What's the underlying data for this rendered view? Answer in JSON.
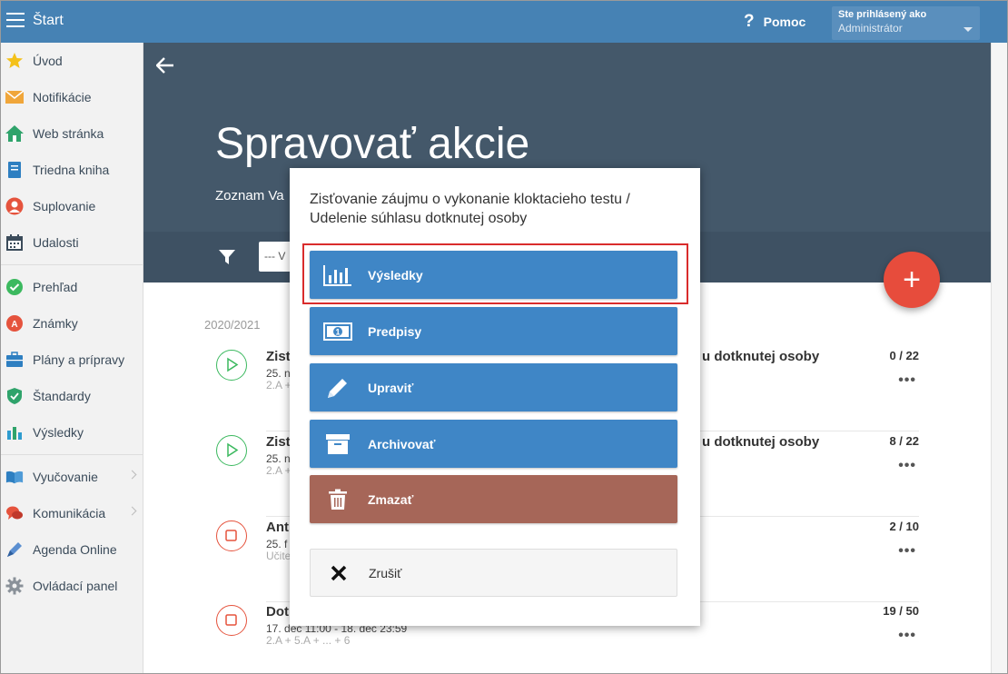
{
  "topbar": {
    "brand": "Štart",
    "help_label": "Pomoc",
    "user_line1": "Ste prihlásený ako",
    "user_line2": "Administrátor"
  },
  "sidebar": {
    "items": [
      {
        "label": "Úvod",
        "icon": "star-icon"
      },
      {
        "label": "Notifikácie",
        "icon": "envelope-icon"
      },
      {
        "label": "Web stránka",
        "icon": "house-icon"
      },
      {
        "label": "Triedna kniha",
        "icon": "book-icon"
      },
      {
        "label": "Suplovanie",
        "icon": "person-icon"
      },
      {
        "label": "Udalosti",
        "icon": "calendar-icon"
      },
      {
        "label": "Prehľad",
        "icon": "check-circle-icon"
      },
      {
        "label": "Známky",
        "icon": "grade-icon"
      },
      {
        "label": "Plány a prípravy",
        "icon": "briefcase-icon"
      },
      {
        "label": "Štandardy",
        "icon": "shield-icon"
      },
      {
        "label": "Výsledky",
        "icon": "bar-chart-icon"
      },
      {
        "label": "Vyučovanie",
        "icon": "open-book-icon"
      },
      {
        "label": "Komunikácia",
        "icon": "chat-icon"
      },
      {
        "label": "Agenda Online",
        "icon": "pen-icon"
      },
      {
        "label": "Ovládací panel",
        "icon": "gear-icon"
      }
    ]
  },
  "hero": {
    "title": "Spravovať akcie",
    "subtitle": "Zoznam Va"
  },
  "filter": {
    "select_value": "--- V"
  },
  "list": {
    "year": "2020/2021",
    "rows": [
      {
        "t1": "Zist",
        "t2": "25. n",
        "t3": "2.A +",
        "right": "u dotknutej osoby",
        "count": "0 / 22",
        "status": "play"
      },
      {
        "t1": "Zist",
        "t2": "25. n",
        "t3": "2.A +",
        "right": "u dotknutej osoby",
        "count": "8 / 22",
        "status": "play"
      },
      {
        "t1": "Ant",
        "t2": "25. f",
        "t3": "Učite",
        "right": "",
        "count": "2 / 10",
        "status": "stop"
      },
      {
        "t1": "Dot",
        "t2": "17. dec 11:00 - 18. dec 23:59",
        "t3": "2.A + 5.A + ... + 6",
        "right": "",
        "count": "19 / 50",
        "status": "stop"
      }
    ],
    "dots": "•••"
  },
  "modal": {
    "title": "Zisťovanie záujmu o vykonanie kloktacieho testu / Udelenie súhlasu dotknutej osoby",
    "buttons": {
      "results": "Výsledky",
      "prescriptions": "Predpisy",
      "edit": "Upraviť",
      "archive": "Archivovať",
      "delete": "Zmazať",
      "cancel": "Zrušiť"
    }
  },
  "colors": {
    "topbar": "#4682b4",
    "hero": "#44586a",
    "button_blue": "#3f86c6",
    "button_delete": "#a66658",
    "fab": "#e74c3c",
    "highlight": "#d92c2c"
  }
}
